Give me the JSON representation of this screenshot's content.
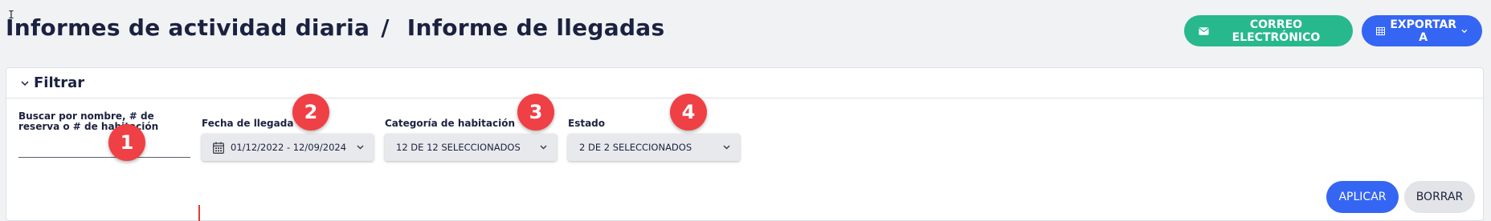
{
  "breadcrumb": {
    "parent": "Informes de actividad diaria",
    "separator": "/",
    "current": "Informe de llegadas"
  },
  "actions": {
    "email_label": "CORREO ELECTRÓNICO",
    "export_label": "EXPORTAR A"
  },
  "filter": {
    "title": "Filtrar",
    "search": {
      "label": "Buscar por nombre, # de reserva o # de habitación",
      "value": ""
    },
    "arrival_date": {
      "label": "Fecha de llegada",
      "value": "01/12/2022 - 12/09/2024"
    },
    "room_category": {
      "label": "Categoría de habitación",
      "value": "12 DE 12 SELECCIONADOS"
    },
    "status": {
      "label": "Estado",
      "value": "2 DE 2 SELECCIONADOS"
    },
    "apply_label": "APLICAR",
    "clear_label": "BORRAR"
  },
  "annotations": [
    "1",
    "2",
    "3",
    "4"
  ],
  "colors": {
    "email_button": "#27b88e",
    "primary_button": "#3565f3",
    "badge": "#ef4045",
    "text": "#1b2240"
  },
  "icons": {
    "email": "envelope-icon",
    "export": "table-icon",
    "calendar": "calendar-icon",
    "chevron": "chevron-down-icon"
  }
}
